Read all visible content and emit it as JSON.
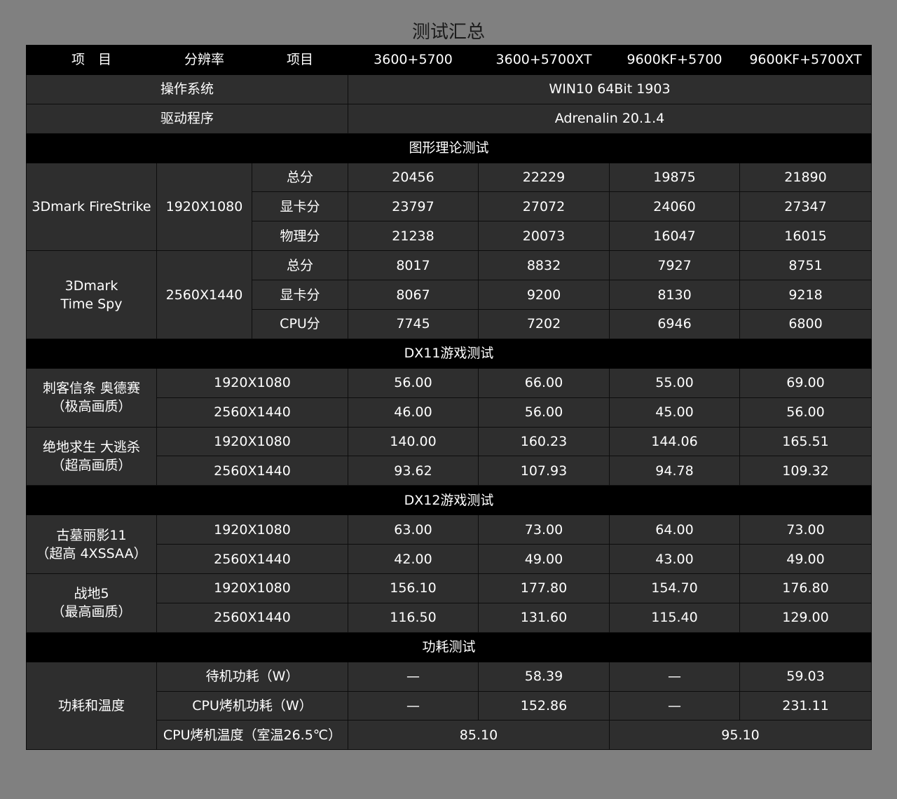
{
  "title": "测试汇总",
  "header": {
    "item": "项　目",
    "resolution": "分辨率",
    "subitem": "项目",
    "configs": [
      "3600+5700",
      "3600+5700XT",
      "9600KF+5700",
      "9600KF+5700XT"
    ]
  },
  "system": {
    "os_label": "操作系统",
    "os_value": "WIN10 64Bit 1903",
    "driver_label": "驱动程序",
    "driver_value": "Adrenalin 20.1.4"
  },
  "sections": {
    "graphics": "图形理论测试",
    "dx11": "DX11游戏测试",
    "dx12": "DX12游戏测试",
    "power": "功耗测试"
  },
  "firestrike": {
    "name": "3Dmark FireStrike",
    "resolution": "1920X1080",
    "rows": [
      {
        "label": "总分",
        "values": [
          "20456",
          "22229",
          "19875",
          "21890"
        ]
      },
      {
        "label": "显卡分",
        "values": [
          "23797",
          "27072",
          "24060",
          "27347"
        ]
      },
      {
        "label": "物理分",
        "values": [
          "21238",
          "20073",
          "16047",
          "16015"
        ]
      }
    ]
  },
  "timespy": {
    "name_line1": "3Dmark",
    "name_line2": "Time Spy",
    "resolution": "2560X1440",
    "rows": [
      {
        "label": "总分",
        "values": [
          "8017",
          "8832",
          "7927",
          "8751"
        ]
      },
      {
        "label": "显卡分",
        "values": [
          "8067",
          "9200",
          "8130",
          "9218"
        ]
      },
      {
        "label": "CPU分",
        "values": [
          "7745",
          "7202",
          "6946",
          "6800"
        ]
      }
    ]
  },
  "dx11_games": [
    {
      "name_line1": "刺客信条 奥德赛",
      "name_line2": "（极高画质）",
      "rows": [
        {
          "resolution": "1920X1080",
          "values": [
            "56.00",
            "66.00",
            "55.00",
            "69.00"
          ]
        },
        {
          "resolution": "2560X1440",
          "values": [
            "46.00",
            "56.00",
            "45.00",
            "56.00"
          ]
        }
      ]
    },
    {
      "name_line1": "绝地求生 大逃杀",
      "name_line2": "（超高画质）",
      "rows": [
        {
          "resolution": "1920X1080",
          "values": [
            "140.00",
            "160.23",
            "144.06",
            "165.51"
          ]
        },
        {
          "resolution": "2560X1440",
          "values": [
            "93.62",
            "107.93",
            "94.78",
            "109.32"
          ]
        }
      ]
    }
  ],
  "dx12_games": [
    {
      "name_line1": "古墓丽影11",
      "name_line2": "（超高 4XSSAA）",
      "rows": [
        {
          "resolution": "1920X1080",
          "values": [
            "63.00",
            "73.00",
            "64.00",
            "73.00"
          ]
        },
        {
          "resolution": "2560X1440",
          "values": [
            "42.00",
            "49.00",
            "43.00",
            "49.00"
          ]
        }
      ]
    },
    {
      "name_line1": "战地5",
      "name_line2": "（最高画质）",
      "rows": [
        {
          "resolution": "1920X1080",
          "values": [
            "156.10",
            "177.80",
            "154.70",
            "176.80"
          ]
        },
        {
          "resolution": "2560X1440",
          "values": [
            "116.50",
            "131.60",
            "115.40",
            "129.00"
          ]
        }
      ]
    }
  ],
  "power": {
    "group_label": "功耗和温度",
    "rows": [
      {
        "label": "待机功耗（W）",
        "values": [
          "—",
          "58.39",
          "—",
          "59.03"
        ]
      },
      {
        "label": "CPU烤机功耗（W）",
        "values": [
          "—",
          "152.86",
          "—",
          "231.11"
        ]
      }
    ],
    "temp": {
      "label": "CPU烤机温度（室温26.5℃）",
      "values": [
        "85.10",
        "95.10"
      ]
    }
  }
}
